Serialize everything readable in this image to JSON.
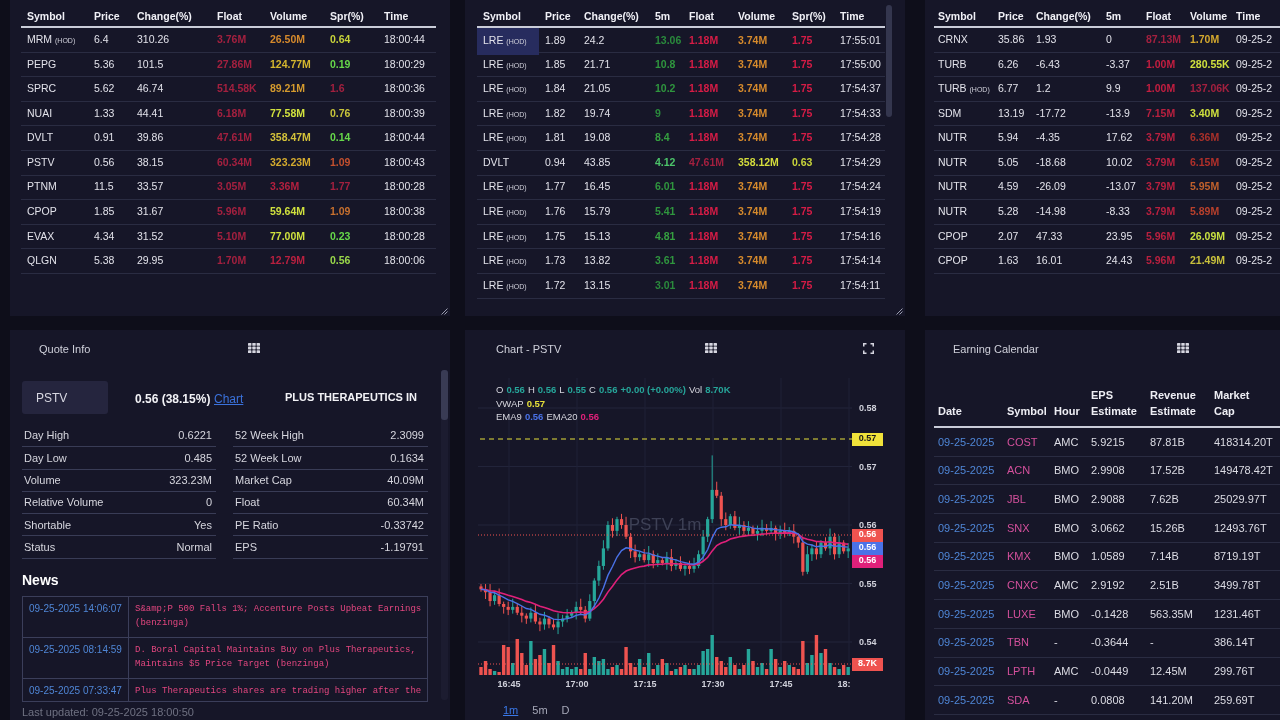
{
  "scanners": [
    {
      "columns": [
        "Symbol",
        "Price",
        "Change(%)",
        "Float",
        "Volume",
        "Spr(%)",
        "Time"
      ],
      "rows": [
        {
          "selected": false,
          "cells": [
            {
              "text": "MRM",
              "tag": "(HOD)"
            },
            "6.4",
            "310.26",
            {
              "text": "3.76M",
              "color": "#a3203f"
            },
            {
              "text": "26.50M",
              "color": "#d68a2c"
            },
            {
              "text": "0.64",
              "color": "#c8d43a"
            },
            "18:00:44"
          ]
        },
        {
          "selected": false,
          "cells": [
            {
              "text": "PEPG"
            },
            "5.36",
            "101.5",
            {
              "text": "27.86M",
              "color": "#a3203f"
            },
            {
              "text": "124.77M",
              "color": "#d4b62e"
            },
            {
              "text": "0.19",
              "color": "#66d84a"
            },
            "18:00:29"
          ]
        },
        {
          "selected": false,
          "cells": [
            {
              "text": "SPRC"
            },
            "5.62",
            "46.74",
            {
              "text": "514.58K",
              "color": "#a3203f"
            },
            {
              "text": "89.21M",
              "color": "#d49a2e"
            },
            {
              "text": "1.6",
              "color": "#a3203f"
            },
            "18:00:36"
          ]
        },
        {
          "selected": false,
          "cells": [
            {
              "text": "NUAI"
            },
            "1.33",
            "44.41",
            {
              "text": "6.18M",
              "color": "#a3203f"
            },
            {
              "text": "77.58M",
              "color": "#d2e23e"
            },
            {
              "text": "0.76",
              "color": "#c8c43a"
            },
            "18:00:39"
          ]
        },
        {
          "selected": false,
          "cells": [
            {
              "text": "DVLT"
            },
            "0.91",
            "39.86",
            {
              "text": "47.61M",
              "color": "#a3203f"
            },
            {
              "text": "358.47M",
              "color": "#d4c23a"
            },
            {
              "text": "0.14",
              "color": "#66d84a"
            },
            "18:00:44"
          ]
        },
        {
          "selected": false,
          "cells": [
            {
              "text": "PSTV"
            },
            "0.56",
            "38.15",
            {
              "text": "60.34M",
              "color": "#a3203f"
            },
            {
              "text": "323.23M",
              "color": "#d4aa2e"
            },
            {
              "text": "1.09",
              "color": "#c4502e"
            },
            "18:00:43"
          ]
        },
        {
          "selected": false,
          "cells": [
            {
              "text": "PTNM"
            },
            "11.5",
            "33.57",
            {
              "text": "3.05M",
              "color": "#a3203f"
            },
            {
              "text": "3.36M",
              "color": "#b3203f"
            },
            {
              "text": "1.77",
              "color": "#a3203f"
            },
            "18:00:28"
          ]
        },
        {
          "selected": false,
          "cells": [
            {
              "text": "CPOP"
            },
            "1.85",
            "31.67",
            {
              "text": "5.96M",
              "color": "#a3203f"
            },
            {
              "text": "59.64M",
              "color": "#cfe03e"
            },
            {
              "text": "1.09",
              "color": "#c8702e"
            },
            "18:00:38"
          ]
        },
        {
          "selected": false,
          "cells": [
            {
              "text": "EVAX"
            },
            "4.34",
            "31.52",
            {
              "text": "5.10M",
              "color": "#a3203f"
            },
            {
              "text": "77.00M",
              "color": "#cfe03e"
            },
            {
              "text": "0.23",
              "color": "#66d84a"
            },
            "18:00:28"
          ]
        },
        {
          "selected": false,
          "cells": [
            {
              "text": "QLGN"
            },
            "5.38",
            "29.95",
            {
              "text": "1.70M",
              "color": "#a3203f"
            },
            {
              "text": "12.79M",
              "color": "#b8203f"
            },
            {
              "text": "0.56",
              "color": "#9ad84a"
            },
            "18:00:06"
          ]
        }
      ]
    },
    {
      "columns": [
        "Symbol",
        "Price",
        "Change(%)",
        "5m",
        "Float",
        "Volume",
        "Spr(%)",
        "Time"
      ],
      "rows": [
        {
          "selected": true,
          "cells": [
            {
              "text": "LRE",
              "tag": "(HOD)"
            },
            "1.89",
            "24.2",
            {
              "text": "13.06",
              "color": "#2a8a3c"
            },
            {
              "text": "1.18M",
              "color": "#d61c46"
            },
            {
              "text": "3.74M",
              "color": "#d68a2c"
            },
            {
              "text": "1.75",
              "color": "#d61c46"
            },
            "17:55:01"
          ]
        },
        {
          "selected": false,
          "cells": [
            {
              "text": "LRE",
              "tag": "(HOD)"
            },
            "1.85",
            "21.71",
            {
              "text": "10.8",
              "color": "#2f963e"
            },
            {
              "text": "1.18M",
              "color": "#d61c46"
            },
            {
              "text": "3.74M",
              "color": "#d68a2c"
            },
            {
              "text": "1.75",
              "color": "#d61c46"
            },
            "17:55:00"
          ]
        },
        {
          "selected": false,
          "cells": [
            {
              "text": "LRE",
              "tag": "(HOD)"
            },
            "1.84",
            "21.05",
            {
              "text": "10.2",
              "color": "#2f963e"
            },
            {
              "text": "1.18M",
              "color": "#d61c46"
            },
            {
              "text": "3.74M",
              "color": "#d68a2c"
            },
            {
              "text": "1.75",
              "color": "#d61c46"
            },
            "17:54:37"
          ]
        },
        {
          "selected": false,
          "cells": [
            {
              "text": "LRE",
              "tag": "(HOD)"
            },
            "1.82",
            "19.74",
            {
              "text": "9",
              "color": "#2a8a3c"
            },
            {
              "text": "1.18M",
              "color": "#d61c46"
            },
            {
              "text": "3.74M",
              "color": "#d68a2c"
            },
            {
              "text": "1.75",
              "color": "#d61c46"
            },
            "17:54:33"
          ]
        },
        {
          "selected": false,
          "cells": [
            {
              "text": "LRE",
              "tag": "(HOD)"
            },
            "1.81",
            "19.08",
            {
              "text": "8.4",
              "color": "#35a040"
            },
            {
              "text": "1.18M",
              "color": "#d61c46"
            },
            {
              "text": "3.74M",
              "color": "#d68a2c"
            },
            {
              "text": "1.75",
              "color": "#d61c46"
            },
            "17:54:28"
          ]
        },
        {
          "selected": false,
          "cells": [
            {
              "text": "DVLT"
            },
            "0.94",
            "43.85",
            {
              "text": "4.12",
              "color": "#4cc46a"
            },
            {
              "text": "47.61M",
              "color": "#a3203f"
            },
            {
              "text": "358.12M",
              "color": "#d4dc3c"
            },
            {
              "text": "0.63",
              "color": "#c8d43a"
            },
            "17:54:29"
          ]
        },
        {
          "selected": false,
          "cells": [
            {
              "text": "LRE",
              "tag": "(HOD)"
            },
            "1.77",
            "16.45",
            {
              "text": "6.01",
              "color": "#2f963e"
            },
            {
              "text": "1.18M",
              "color": "#d61c46"
            },
            {
              "text": "3.74M",
              "color": "#d68a2c"
            },
            {
              "text": "1.75",
              "color": "#d61c46"
            },
            "17:54:24"
          ]
        },
        {
          "selected": false,
          "cells": [
            {
              "text": "LRE",
              "tag": "(HOD)"
            },
            "1.76",
            "15.79",
            {
              "text": "5.41",
              "color": "#2f963e"
            },
            {
              "text": "1.18M",
              "color": "#d61c46"
            },
            {
              "text": "3.74M",
              "color": "#d68a2c"
            },
            {
              "text": "1.75",
              "color": "#d61c46"
            },
            "17:54:19"
          ]
        },
        {
          "selected": false,
          "cells": [
            {
              "text": "LRE",
              "tag": "(HOD)"
            },
            "1.75",
            "15.13",
            {
              "text": "4.81",
              "color": "#35a040"
            },
            {
              "text": "1.18M",
              "color": "#d61c46"
            },
            {
              "text": "3.74M",
              "color": "#d68a2c"
            },
            {
              "text": "1.75",
              "color": "#d61c46"
            },
            "17:54:16"
          ]
        },
        {
          "selected": false,
          "cells": [
            {
              "text": "LRE",
              "tag": "(HOD)"
            },
            "1.73",
            "13.82",
            {
              "text": "3.61",
              "color": "#2f963e"
            },
            {
              "text": "1.18M",
              "color": "#d61c46"
            },
            {
              "text": "3.74M",
              "color": "#d68a2c"
            },
            {
              "text": "1.75",
              "color": "#d61c46"
            },
            "17:54:14"
          ]
        },
        {
          "selected": false,
          "cells": [
            {
              "text": "LRE",
              "tag": "(HOD)"
            },
            "1.72",
            "13.15",
            {
              "text": "3.01",
              "color": "#2a8a3c"
            },
            {
              "text": "1.18M",
              "color": "#d61c46"
            },
            {
              "text": "3.74M",
              "color": "#d68a2c"
            },
            {
              "text": "1.75",
              "color": "#d61c46"
            },
            "17:54:11"
          ]
        }
      ]
    },
    {
      "columns": [
        "Symbol",
        "Price",
        "Change(%)",
        "5m",
        "Float",
        "Volume",
        "Time"
      ],
      "rows": [
        {
          "selected": false,
          "cells": [
            {
              "text": "CRNX"
            },
            "35.86",
            "1.93",
            "0",
            {
              "text": "87.13M",
              "color": "#a3203f"
            },
            {
              "text": "1.70M",
              "color": "#d4a82e"
            },
            "09-25-2"
          ]
        },
        {
          "selected": false,
          "cells": [
            {
              "text": "TURB"
            },
            "6.26",
            "-6.43",
            "-3.37",
            {
              "text": "1.00M",
              "color": "#c41e40"
            },
            {
              "text": "280.55K",
              "color": "#cfe03e"
            },
            "09-25-2"
          ]
        },
        {
          "selected": false,
          "cells": [
            {
              "text": "TURB",
              "tag": "(HOD)"
            },
            "6.77",
            "1.2",
            "9.9",
            {
              "text": "1.00M",
              "color": "#c41e40"
            },
            {
              "text": "137.06K",
              "color": "#a3203f"
            },
            "09-25-2"
          ]
        },
        {
          "selected": false,
          "cells": [
            {
              "text": "SDM"
            },
            "13.19",
            "-17.72",
            "-13.9",
            {
              "text": "7.15M",
              "color": "#b8203f"
            },
            {
              "text": "3.40M",
              "color": "#cfe03e"
            },
            "09-25-2"
          ]
        },
        {
          "selected": false,
          "cells": [
            {
              "text": "NUTR"
            },
            "5.94",
            "-4.35",
            "17.62",
            {
              "text": "3.79M",
              "color": "#b8203f"
            },
            {
              "text": "6.36M",
              "color": "#a8302a"
            },
            "09-25-2"
          ]
        },
        {
          "selected": false,
          "cells": [
            {
              "text": "NUTR"
            },
            "5.05",
            "-18.68",
            "10.02",
            {
              "text": "3.79M",
              "color": "#b8203f"
            },
            {
              "text": "6.15M",
              "color": "#b0302a"
            },
            "09-25-2"
          ]
        },
        {
          "selected": false,
          "cells": [
            {
              "text": "NUTR"
            },
            "4.59",
            "-26.09",
            "-13.07",
            {
              "text": "3.79M",
              "color": "#b8203f"
            },
            {
              "text": "5.95M",
              "color": "#c0602c"
            },
            "09-25-2"
          ]
        },
        {
          "selected": false,
          "cells": [
            {
              "text": "NUTR"
            },
            "5.28",
            "-14.98",
            "-8.33",
            {
              "text": "3.79M",
              "color": "#b8203f"
            },
            {
              "text": "5.89M",
              "color": "#b8402c"
            },
            "09-25-2"
          ]
        },
        {
          "selected": false,
          "cells": [
            {
              "text": "CPOP"
            },
            "2.07",
            "47.33",
            "23.95",
            {
              "text": "5.96M",
              "color": "#b8203f"
            },
            {
              "text": "26.09M",
              "color": "#c8e040"
            },
            "09-25-2"
          ]
        },
        {
          "selected": false,
          "cells": [
            {
              "text": "CPOP"
            },
            "1.63",
            "16.01",
            "24.43",
            {
              "text": "5.96M",
              "color": "#b8203f"
            },
            {
              "text": "21.49M",
              "color": "#c8c03c"
            },
            "09-25-2"
          ]
        }
      ]
    }
  ],
  "quote_info": {
    "title": "Quote Info",
    "symbol": "PSTV",
    "price_change": "0.56 (38.15%)",
    "chart_link": "Chart",
    "company": "PLUS THERAPEUTICS IN",
    "stats": [
      [
        {
          "label": "Day High",
          "value": "0.6221"
        },
        {
          "label": "Day Low",
          "value": "0.485"
        },
        {
          "label": "Volume",
          "value": "323.23M"
        },
        {
          "label": "Relative Volume",
          "value": "0"
        },
        {
          "label": "Shortable",
          "value": "Yes"
        },
        {
          "label": "Status",
          "value": "Normal"
        }
      ],
      [
        {
          "label": "52 Week High",
          "value": "2.3099"
        },
        {
          "label": "52 Week Low",
          "value": "0.1634"
        },
        {
          "label": "Market Cap",
          "value": "40.09M"
        },
        {
          "label": "Float",
          "value": "60.34M"
        },
        {
          "label": "PE Ratio",
          "value": "-0.33742"
        },
        {
          "label": "EPS",
          "value": "-1.19791"
        }
      ]
    ],
    "news": {
      "title": "News",
      "items": [
        {
          "time": "09-25-2025 14:06:07",
          "headline": "S&amp;P 500 Falls 1%; Accenture Posts Upbeat Earnings (benzinga)"
        },
        {
          "time": "09-25-2025 08:14:59",
          "headline": "D. Boral Capital Maintains Buy on Plus Therapeutics, Maintains $5 Price Target (benzinga)"
        },
        {
          "time": "09-25-2025 07:33:47",
          "headline": "Plus Therapeutics shares are trading higher after the"
        }
      ]
    },
    "last_updated": "Last updated: 09-25-2025 18:00:50"
  },
  "chart": {
    "title": "Chart - PSTV",
    "legend": [
      [
        {
          "label": "O",
          "value": "0.56",
          "color": "#26a69a"
        },
        {
          "label": "H",
          "value": "0.56",
          "color": "#26a69a"
        },
        {
          "label": "L",
          "value": "0.55",
          "color": "#26a69a"
        },
        {
          "label": "C",
          "value": "0.56",
          "color": "#26a69a"
        },
        {
          "value": "+0.00 (+0.00%)",
          "color": "#26a69a"
        },
        {
          "label": "Vol",
          "value": "8.70K",
          "color": "#26a69a"
        }
      ],
      [
        {
          "label": "VWAP",
          "value": "0.57",
          "color": "#e6e03a"
        }
      ],
      [
        {
          "label": "EMA9",
          "value": "0.56",
          "color": "#4a72e8"
        },
        {
          "label": "EMA20",
          "value": "0.56",
          "color": "#e0207a"
        }
      ]
    ],
    "watermark": "PSTV 1m",
    "price_axis": [
      "0.58",
      "0.57",
      "0.56",
      "0.55",
      "0.54"
    ],
    "time_axis": [
      "16:45",
      "17:00",
      "17:15",
      "17:30",
      "17:45",
      "18:"
    ],
    "price_tags": [
      {
        "kind": "vwap",
        "text": "0.57",
        "color": "#f0e23a"
      },
      {
        "kind": "last",
        "text": "0.56",
        "color": "#ef5350"
      },
      {
        "kind": "ema9",
        "text": "0.56",
        "color": "#4a72e8"
      },
      {
        "kind": "ema20",
        "text": "0.56",
        "color": "#e0207a"
      },
      {
        "kind": "volume",
        "text": "8.7K",
        "color": "#ef5350"
      }
    ],
    "timeframes": [
      {
        "label": "1m",
        "selected": true
      },
      {
        "label": "5m",
        "selected": false
      },
      {
        "label": "D",
        "selected": false
      }
    ]
  },
  "earning_calendar": {
    "title": "Earning Calendar",
    "columns": [
      "Date",
      "Symbol",
      "Hour",
      "EPS Estimate",
      "Revenue Estimate",
      "Market Cap"
    ],
    "rows": [
      [
        "09-25-2025",
        "COST",
        "AMC",
        "5.9215",
        "87.81B",
        "418314.20T"
      ],
      [
        "09-25-2025",
        "ACN",
        "BMO",
        "2.9908",
        "17.52B",
        "149478.42T"
      ],
      [
        "09-25-2025",
        "JBL",
        "BMO",
        "2.9088",
        "7.62B",
        "25029.97T"
      ],
      [
        "09-25-2025",
        "SNX",
        "BMO",
        "3.0662",
        "15.26B",
        "12493.76T"
      ],
      [
        "09-25-2025",
        "KMX",
        "BMO",
        "1.0589",
        "7.14B",
        "8719.19T"
      ],
      [
        "09-25-2025",
        "CNXC",
        "AMC",
        "2.9192",
        "2.51B",
        "3499.78T"
      ],
      [
        "09-25-2025",
        "LUXE",
        "BMO",
        "-0.1428",
        "563.35M",
        "1231.46T"
      ],
      [
        "09-25-2025",
        "TBN",
        "-",
        "-0.3644",
        "-",
        "386.14T"
      ],
      [
        "09-25-2025",
        "LPTH",
        "AMC",
        "-0.0449",
        "12.45M",
        "299.76T"
      ],
      [
        "09-25-2025",
        "SDA",
        "-",
        "0.0808",
        "141.20M",
        "259.69T"
      ]
    ]
  }
}
